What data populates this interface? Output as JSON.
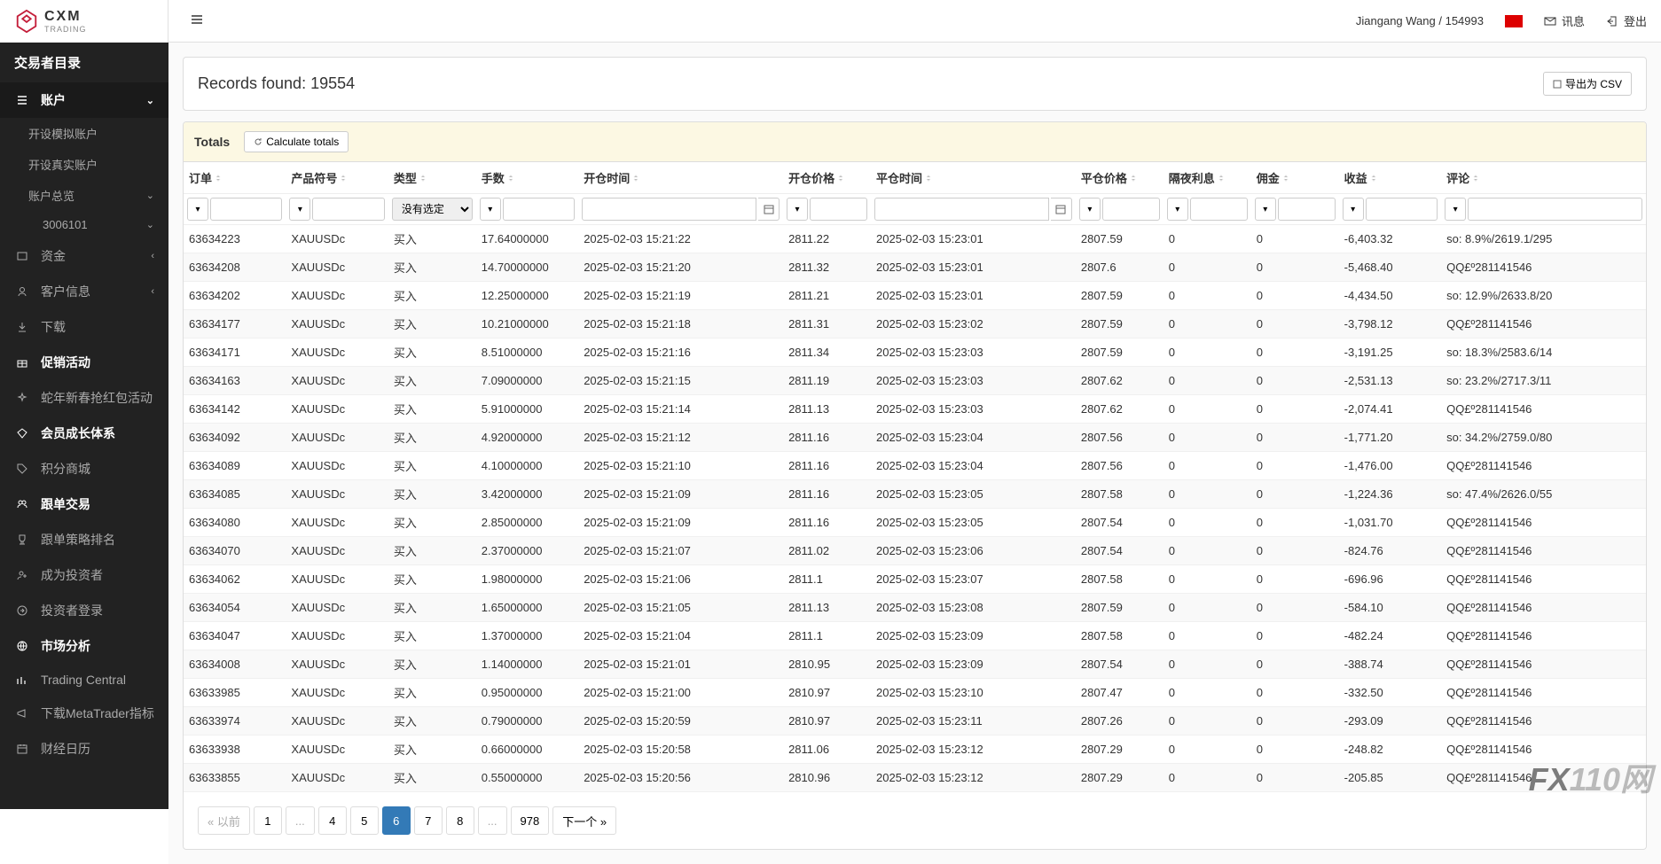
{
  "logo": {
    "cxm": "CXM",
    "trading": "TRADING"
  },
  "header": {
    "user": "Jiangang Wang / 154993",
    "messages": "讯息",
    "login": "登出"
  },
  "sidebar": {
    "title": "交易者目录",
    "account": "账户",
    "open_demo": "开设模拟账户",
    "open_real": "开设真实账户",
    "account_overview": "账户总览",
    "account_id": "3006101",
    "funds": "资金",
    "customer_info": "客户信息",
    "download": "下载",
    "promo": "促销活动",
    "promo_event": "蛇年新春抢红包活动",
    "member": "会员成长体系",
    "points": "积分商城",
    "copy_trade": "跟单交易",
    "strategy_rank": "跟单策略排名",
    "become_investor": "成为投资者",
    "investor_login": "投资者登录",
    "market": "市场分析",
    "trading_central": "Trading Central",
    "mt_indicator": "下载MetaTrader指标",
    "calendar": "财经日历"
  },
  "records": {
    "label": "Records found: 19554",
    "export": "导出为 CSV"
  },
  "totals": {
    "label": "Totals",
    "calc": "Calculate totals"
  },
  "columns": {
    "order": "订单",
    "symbol": "产品符号",
    "type": "类型",
    "lots": "手数",
    "open_time": "开仓时间",
    "open_price": "开仓价格",
    "close_time": "平仓时间",
    "close_price": "平仓价格",
    "swap": "隔夜利息",
    "commission": "佣金",
    "profit": "收益",
    "comment": "评论"
  },
  "type_filter_placeholder": "没有选定",
  "rows": [
    {
      "order": "63634223",
      "symbol": "XAUUSDc",
      "type": "买入",
      "lots": "17.64000000",
      "open_time": "2025-02-03 15:21:22",
      "open_price": "2811.22",
      "close_time": "2025-02-03 15:23:01",
      "close_price": "2807.59",
      "swap": "0",
      "commission": "0",
      "profit": "-6,403.32",
      "comment": "so: 8.9%/2619.1/295"
    },
    {
      "order": "63634208",
      "symbol": "XAUUSDc",
      "type": "买入",
      "lots": "14.70000000",
      "open_time": "2025-02-03 15:21:20",
      "open_price": "2811.32",
      "close_time": "2025-02-03 15:23:01",
      "close_price": "2807.6",
      "swap": "0",
      "commission": "0",
      "profit": "-5,468.40",
      "comment": "QQ£º281141546"
    },
    {
      "order": "63634202",
      "symbol": "XAUUSDc",
      "type": "买入",
      "lots": "12.25000000",
      "open_time": "2025-02-03 15:21:19",
      "open_price": "2811.21",
      "close_time": "2025-02-03 15:23:01",
      "close_price": "2807.59",
      "swap": "0",
      "commission": "0",
      "profit": "-4,434.50",
      "comment": "so: 12.9%/2633.8/20"
    },
    {
      "order": "63634177",
      "symbol": "XAUUSDc",
      "type": "买入",
      "lots": "10.21000000",
      "open_time": "2025-02-03 15:21:18",
      "open_price": "2811.31",
      "close_time": "2025-02-03 15:23:02",
      "close_price": "2807.59",
      "swap": "0",
      "commission": "0",
      "profit": "-3,798.12",
      "comment": "QQ£º281141546"
    },
    {
      "order": "63634171",
      "symbol": "XAUUSDc",
      "type": "买入",
      "lots": "8.51000000",
      "open_time": "2025-02-03 15:21:16",
      "open_price": "2811.34",
      "close_time": "2025-02-03 15:23:03",
      "close_price": "2807.59",
      "swap": "0",
      "commission": "0",
      "profit": "-3,191.25",
      "comment": "so: 18.3%/2583.6/14"
    },
    {
      "order": "63634163",
      "symbol": "XAUUSDc",
      "type": "买入",
      "lots": "7.09000000",
      "open_time": "2025-02-03 15:21:15",
      "open_price": "2811.19",
      "close_time": "2025-02-03 15:23:03",
      "close_price": "2807.62",
      "swap": "0",
      "commission": "0",
      "profit": "-2,531.13",
      "comment": "so: 23.2%/2717.3/11"
    },
    {
      "order": "63634142",
      "symbol": "XAUUSDc",
      "type": "买入",
      "lots": "5.91000000",
      "open_time": "2025-02-03 15:21:14",
      "open_price": "2811.13",
      "close_time": "2025-02-03 15:23:03",
      "close_price": "2807.62",
      "swap": "0",
      "commission": "0",
      "profit": "-2,074.41",
      "comment": "QQ£º281141546"
    },
    {
      "order": "63634092",
      "symbol": "XAUUSDc",
      "type": "买入",
      "lots": "4.92000000",
      "open_time": "2025-02-03 15:21:12",
      "open_price": "2811.16",
      "close_time": "2025-02-03 15:23:04",
      "close_price": "2807.56",
      "swap": "0",
      "commission": "0",
      "profit": "-1,771.20",
      "comment": "so: 34.2%/2759.0/80"
    },
    {
      "order": "63634089",
      "symbol": "XAUUSDc",
      "type": "买入",
      "lots": "4.10000000",
      "open_time": "2025-02-03 15:21:10",
      "open_price": "2811.16",
      "close_time": "2025-02-03 15:23:04",
      "close_price": "2807.56",
      "swap": "0",
      "commission": "0",
      "profit": "-1,476.00",
      "comment": "QQ£º281141546"
    },
    {
      "order": "63634085",
      "symbol": "XAUUSDc",
      "type": "买入",
      "lots": "3.42000000",
      "open_time": "2025-02-03 15:21:09",
      "open_price": "2811.16",
      "close_time": "2025-02-03 15:23:05",
      "close_price": "2807.58",
      "swap": "0",
      "commission": "0",
      "profit": "-1,224.36",
      "comment": "so: 47.4%/2626.0/55"
    },
    {
      "order": "63634080",
      "symbol": "XAUUSDc",
      "type": "买入",
      "lots": "2.85000000",
      "open_time": "2025-02-03 15:21:09",
      "open_price": "2811.16",
      "close_time": "2025-02-03 15:23:05",
      "close_price": "2807.54",
      "swap": "0",
      "commission": "0",
      "profit": "-1,031.70",
      "comment": "QQ£º281141546"
    },
    {
      "order": "63634070",
      "symbol": "XAUUSDc",
      "type": "买入",
      "lots": "2.37000000",
      "open_time": "2025-02-03 15:21:07",
      "open_price": "2811.02",
      "close_time": "2025-02-03 15:23:06",
      "close_price": "2807.54",
      "swap": "0",
      "commission": "0",
      "profit": "-824.76",
      "comment": "QQ£º281141546"
    },
    {
      "order": "63634062",
      "symbol": "XAUUSDc",
      "type": "买入",
      "lots": "1.98000000",
      "open_time": "2025-02-03 15:21:06",
      "open_price": "2811.1",
      "close_time": "2025-02-03 15:23:07",
      "close_price": "2807.58",
      "swap": "0",
      "commission": "0",
      "profit": "-696.96",
      "comment": "QQ£º281141546"
    },
    {
      "order": "63634054",
      "symbol": "XAUUSDc",
      "type": "买入",
      "lots": "1.65000000",
      "open_time": "2025-02-03 15:21:05",
      "open_price": "2811.13",
      "close_time": "2025-02-03 15:23:08",
      "close_price": "2807.59",
      "swap": "0",
      "commission": "0",
      "profit": "-584.10",
      "comment": "QQ£º281141546"
    },
    {
      "order": "63634047",
      "symbol": "XAUUSDc",
      "type": "买入",
      "lots": "1.37000000",
      "open_time": "2025-02-03 15:21:04",
      "open_price": "2811.1",
      "close_time": "2025-02-03 15:23:09",
      "close_price": "2807.58",
      "swap": "0",
      "commission": "0",
      "profit": "-482.24",
      "comment": "QQ£º281141546"
    },
    {
      "order": "63634008",
      "symbol": "XAUUSDc",
      "type": "买入",
      "lots": "1.14000000",
      "open_time": "2025-02-03 15:21:01",
      "open_price": "2810.95",
      "close_time": "2025-02-03 15:23:09",
      "close_price": "2807.54",
      "swap": "0",
      "commission": "0",
      "profit": "-388.74",
      "comment": "QQ£º281141546"
    },
    {
      "order": "63633985",
      "symbol": "XAUUSDc",
      "type": "买入",
      "lots": "0.95000000",
      "open_time": "2025-02-03 15:21:00",
      "open_price": "2810.97",
      "close_time": "2025-02-03 15:23:10",
      "close_price": "2807.47",
      "swap": "0",
      "commission": "0",
      "profit": "-332.50",
      "comment": "QQ£º281141546"
    },
    {
      "order": "63633974",
      "symbol": "XAUUSDc",
      "type": "买入",
      "lots": "0.79000000",
      "open_time": "2025-02-03 15:20:59",
      "open_price": "2810.97",
      "close_time": "2025-02-03 15:23:11",
      "close_price": "2807.26",
      "swap": "0",
      "commission": "0",
      "profit": "-293.09",
      "comment": "QQ£º281141546"
    },
    {
      "order": "63633938",
      "symbol": "XAUUSDc",
      "type": "买入",
      "lots": "0.66000000",
      "open_time": "2025-02-03 15:20:58",
      "open_price": "2811.06",
      "close_time": "2025-02-03 15:23:12",
      "close_price": "2807.29",
      "swap": "0",
      "commission": "0",
      "profit": "-248.82",
      "comment": "QQ£º281141546"
    },
    {
      "order": "63633855",
      "symbol": "XAUUSDc",
      "type": "买入",
      "lots": "0.55000000",
      "open_time": "2025-02-03 15:20:56",
      "open_price": "2810.96",
      "close_time": "2025-02-03 15:23:12",
      "close_price": "2807.29",
      "swap": "0",
      "commission": "0",
      "profit": "-205.85",
      "comment": "QQ£º281141546"
    }
  ],
  "pagination": {
    "prev": "« 以前",
    "p1": "1",
    "dots": "...",
    "p4": "4",
    "p5": "5",
    "p6": "6",
    "p7": "7",
    "p8": "8",
    "last": "978",
    "next": "下一个 »"
  },
  "watermark": {
    "fx": "FX",
    "rest": "110网"
  }
}
